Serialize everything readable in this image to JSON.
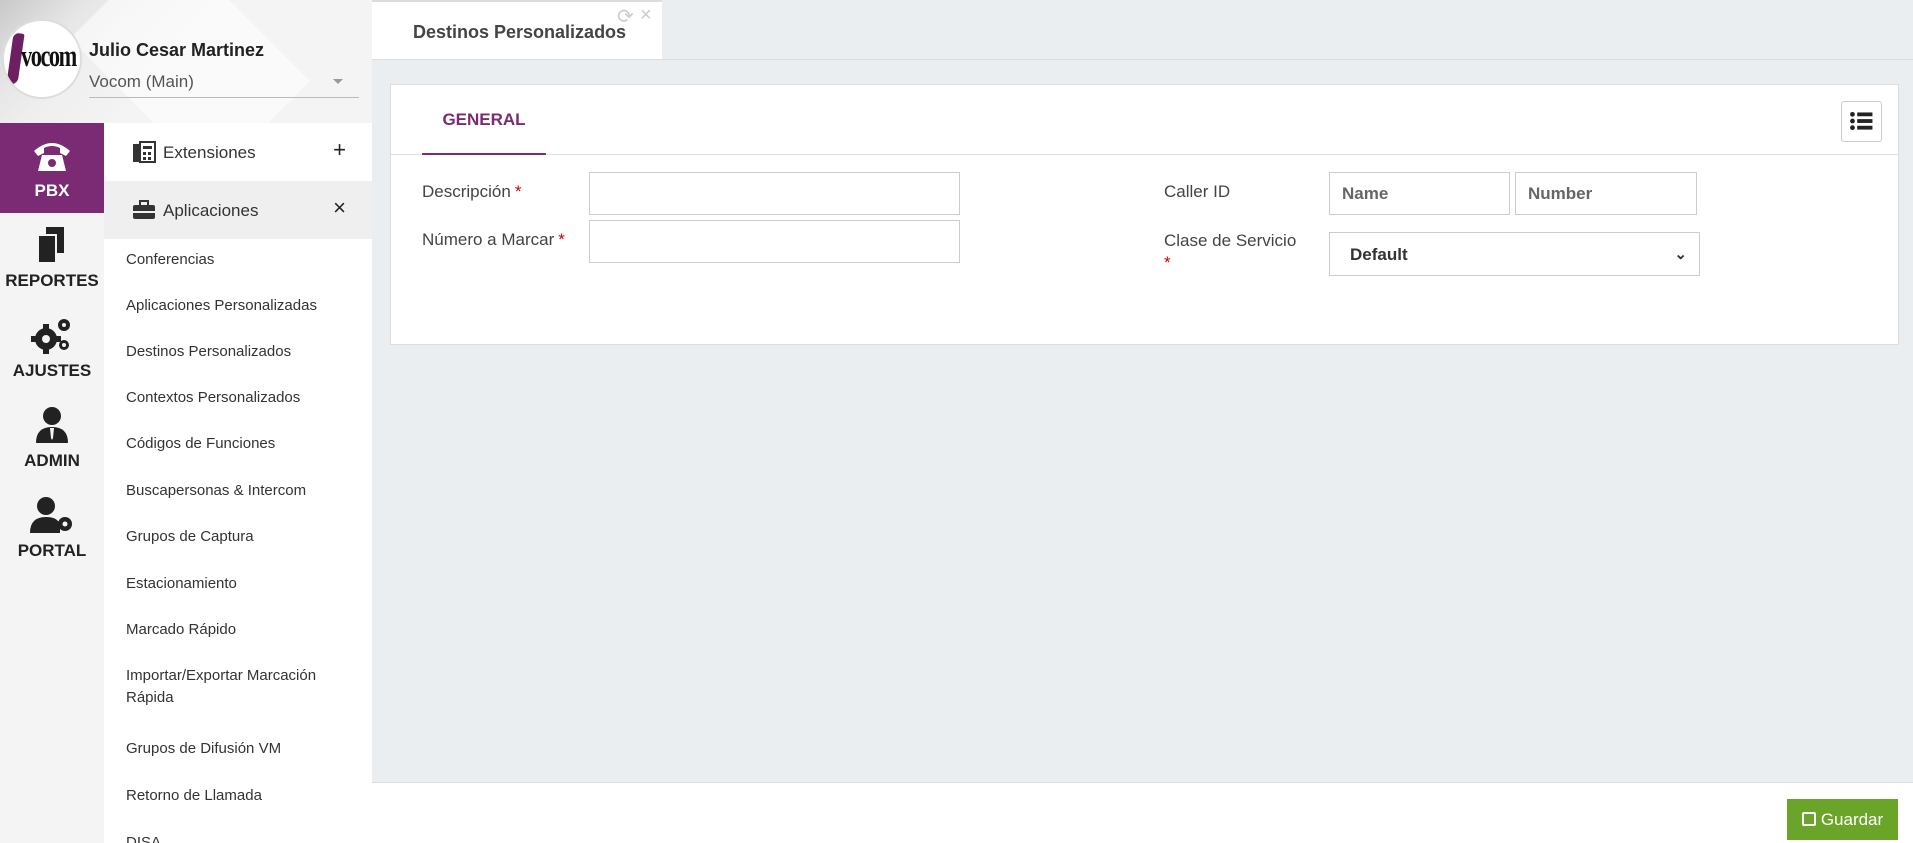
{
  "user": {
    "name": "Julio Cesar Martinez",
    "tenant": "Vocom (Main)",
    "logo_text": "vocom"
  },
  "rail": [
    {
      "label": "PBX",
      "icon": "phone-icon"
    },
    {
      "label": "REPORTES",
      "icon": "documents-icon"
    },
    {
      "label": "AJUSTES",
      "icon": "gears-icon"
    },
    {
      "label": "ADMIN",
      "icon": "admin-user-icon"
    },
    {
      "label": "PORTAL",
      "icon": "user-gear-icon"
    }
  ],
  "menu": {
    "extensiones": {
      "label": "Extensiones",
      "action": "+"
    },
    "aplicaciones": {
      "label": "Aplicaciones",
      "action": "×"
    },
    "items": [
      "Conferencias",
      "Aplicaciones Personalizadas",
      "Destinos Personalizados",
      "Contextos Personalizados",
      "Códigos de Funciones",
      "Buscapersonas & Intercom",
      "Grupos de Captura",
      "Estacionamiento",
      "Marcado Rápido",
      "Importar/Exportar Marcación Rápida",
      "Grupos de Difusión VM",
      "Retorno de Llamada",
      "DISA"
    ]
  },
  "tab": {
    "title": "Destinos Personalizados"
  },
  "form": {
    "tab_general": "GENERAL",
    "descripcion_label": "Descripción",
    "numero_label": "Número a Marcar",
    "required_mark": "*",
    "callerid_label": "Caller ID",
    "callerid_name_placeholder": "Name",
    "callerid_number_placeholder": "Number",
    "clase_label": "Clase de Servicio",
    "clase_value": "Default"
  },
  "footer": {
    "save_label": "Guardar"
  },
  "colors": {
    "accent": "#7b2b73",
    "save": "#6aa52a"
  }
}
